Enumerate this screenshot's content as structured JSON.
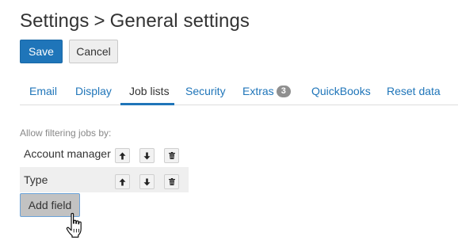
{
  "header": {
    "title_part1": "Settings",
    "separator": ">",
    "title_part2": "General settings"
  },
  "actions": {
    "save_label": "Save",
    "cancel_label": "Cancel"
  },
  "tabs": [
    {
      "label": "Email",
      "active": false
    },
    {
      "label": "Display",
      "active": false
    },
    {
      "label": "Job lists",
      "active": true
    },
    {
      "label": "Security",
      "active": false
    },
    {
      "label": "Extras",
      "badge": "3",
      "active": false
    },
    {
      "label": "QuickBooks",
      "active": false
    },
    {
      "label": "Reset data",
      "active": false
    }
  ],
  "filter": {
    "label": "Allow filtering jobs by:",
    "fields": [
      {
        "name": "Account manager"
      },
      {
        "name": "Type"
      }
    ],
    "add_field_label": "Add field"
  },
  "icons": {
    "move_up": "arrow-up-icon",
    "move_down": "arrow-down-icon",
    "delete": "trash-icon",
    "pointer": "hand-pointer-icon"
  },
  "colors": {
    "accent": "#1f75b9",
    "badge": "#8f8f8f",
    "add_button_border": "#6aa2d8"
  }
}
